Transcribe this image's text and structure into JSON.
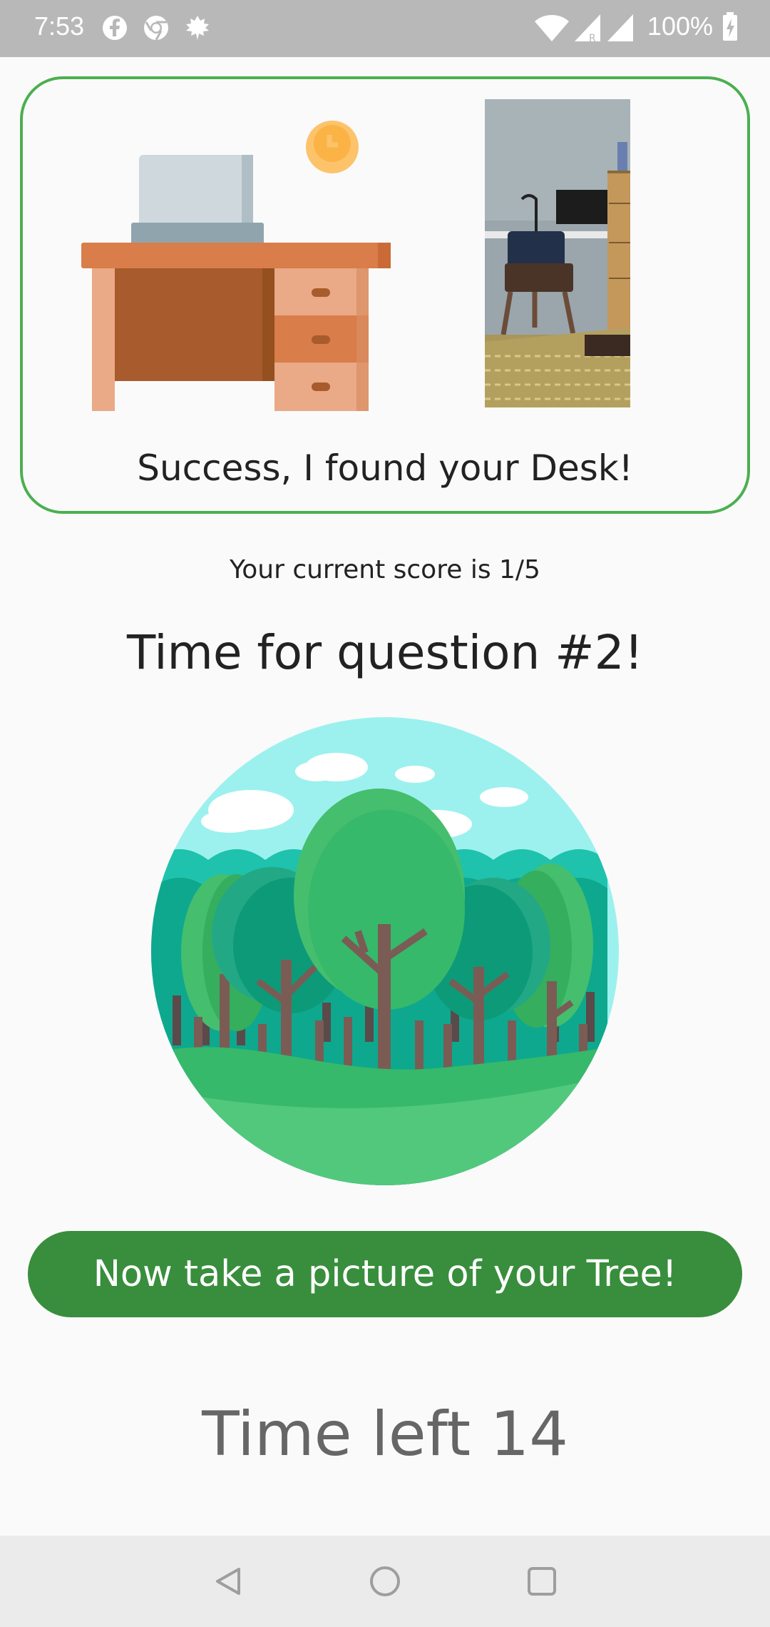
{
  "status_bar": {
    "time": "7:53",
    "notification_icons": [
      "facebook-icon",
      "chrome-icon",
      "leaf-icon"
    ],
    "system_icons": [
      "wifi-icon",
      "signal-roaming-icon",
      "signal-icon"
    ],
    "battery_percent": "100%"
  },
  "result_card": {
    "message": "Success, I found your Desk!",
    "border_color": "#4caf50",
    "illustration": "desk-illustration",
    "photo": "captured-desk-photo"
  },
  "score_text": "Your current score is 1/5",
  "question_title": "Time for question #2!",
  "question_illustration": "forest-illustration",
  "action_button": {
    "label": "Now take a picture of your Tree!",
    "color": "#388e3c"
  },
  "timer_text": "Time left 14",
  "nav_bar": {
    "buttons": [
      "back-icon",
      "home-icon",
      "recents-icon"
    ]
  }
}
